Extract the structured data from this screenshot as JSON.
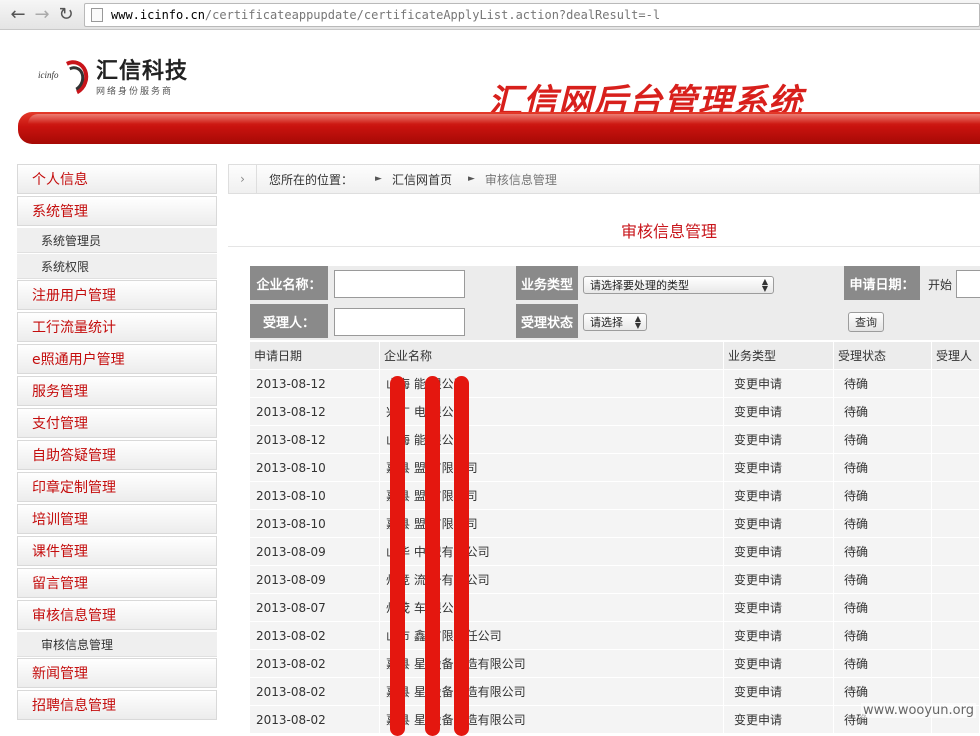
{
  "browser": {
    "url_host": "www.icinfo.cn",
    "url_path": "/certificateappupdate/certificateApplyList.action?dealResult=-l"
  },
  "header": {
    "logo_small": "icinfo",
    "logo_name": "汇信科技",
    "logo_sub": "网络身份服务商",
    "system_title": "汇信网后台管理系统"
  },
  "sidebar": {
    "items": [
      {
        "label": "个人信息",
        "children": []
      },
      {
        "label": "系统管理",
        "children": [
          "系统管理员",
          "系统权限"
        ]
      },
      {
        "label": "注册用户管理",
        "children": []
      },
      {
        "label": "工行流量统计",
        "children": []
      },
      {
        "label": "e照通用户管理",
        "children": []
      },
      {
        "label": "服务管理",
        "children": []
      },
      {
        "label": "支付管理",
        "children": []
      },
      {
        "label": "自助答疑管理",
        "children": []
      },
      {
        "label": "印章定制管理",
        "children": []
      },
      {
        "label": "培训管理",
        "children": []
      },
      {
        "label": "课件管理",
        "children": []
      },
      {
        "label": "留言管理",
        "children": []
      },
      {
        "label": "审核信息管理",
        "children": [
          "审核信息管理"
        ]
      },
      {
        "label": "新闻管理",
        "children": []
      },
      {
        "label": "招聘信息管理",
        "children": []
      }
    ]
  },
  "breadcrumb": {
    "lead": "您所在的位置：",
    "home": "汇信网首页",
    "current": "审核信息管理"
  },
  "main": {
    "title": "审核信息管理"
  },
  "filter": {
    "company_label": "企业名称：",
    "biz_type_label": "业务类型",
    "biz_type_value": "请选择要处理的类型",
    "apply_date_label": "申请日期：",
    "start_label": "开始",
    "handler_label": "受理人：",
    "status_label": "受理状态",
    "status_value": "请选择",
    "query_button": "查询"
  },
  "table": {
    "headers": [
      "申请日期",
      "企业名称",
      "业务类型",
      "受理状态",
      "受理人"
    ],
    "rows": [
      {
        "date": "2013-08-12",
        "name": "山海 能 限公司",
        "type": "变更申请",
        "status": "待确"
      },
      {
        "date": "2013-08-12",
        "name": "兴广 电 限公司",
        "type": "变更申请",
        "status": "待确"
      },
      {
        "date": "2013-08-12",
        "name": "山海 能 限公司",
        "type": "变更申请",
        "status": "待确"
      },
      {
        "date": "2013-08-10",
        "name": "嘉县 盟 有限公司",
        "type": "变更申请",
        "status": "待确"
      },
      {
        "date": "2013-08-10",
        "name": "嘉县 盟 有限公司",
        "type": "变更申请",
        "status": "待确"
      },
      {
        "date": "2013-08-10",
        "name": "嘉县 盟 有限公司",
        "type": "变更申请",
        "status": "待确"
      },
      {
        "date": "2013-08-09",
        "name": "山华 中 织有限公司",
        "type": "变更申请",
        "status": "待确"
      },
      {
        "date": "2013-08-09",
        "name": "州竞 流 备有限公司",
        "type": "变更申请",
        "status": "待确"
      },
      {
        "date": "2013-08-07",
        "name": "州茂 车 限公司",
        "type": "变更申请",
        "status": "待确"
      },
      {
        "date": "2013-08-02",
        "name": "山市 鑫 有限责任公司",
        "type": "变更申请",
        "status": "待确"
      },
      {
        "date": "2013-08-02",
        "name": "嘉县 星 设备制造有限公司",
        "type": "变更申请",
        "status": "待确"
      },
      {
        "date": "2013-08-02",
        "name": "嘉县 星 设备制造有限公司",
        "type": "变更申请",
        "status": "待确"
      },
      {
        "date": "2013-08-02",
        "name": "嘉县 星 设备制造有限公司",
        "type": "变更申请",
        "status": "待确"
      }
    ]
  },
  "watermark": "www.wooyun.org",
  "colors": {
    "accent": "#d8201c",
    "menu_text": "#c40d0d",
    "filter_label_bg": "#8a8a8a"
  }
}
